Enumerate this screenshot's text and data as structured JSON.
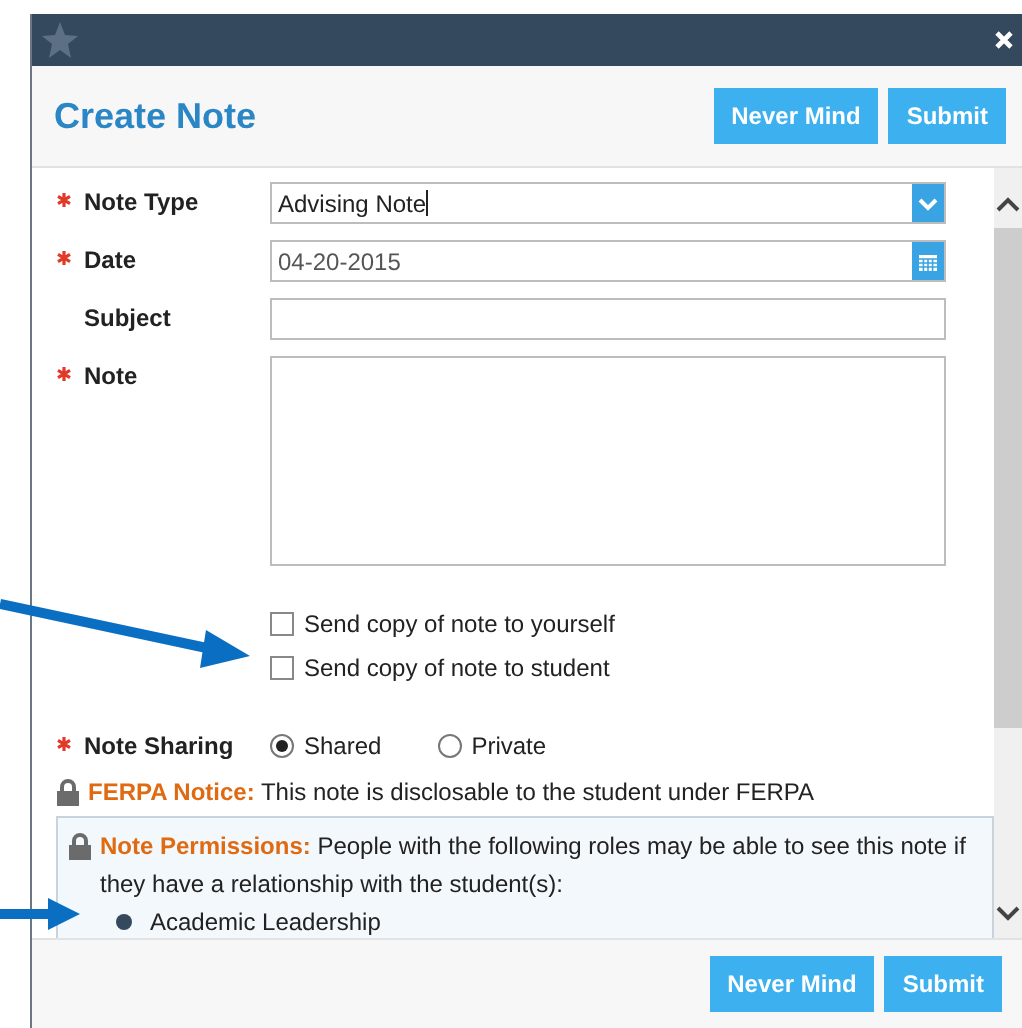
{
  "window": {
    "title": "Create Note"
  },
  "header_buttons": [
    "Never Mind",
    "Submit"
  ],
  "fields": [
    {
      "kind": "select",
      "label": "Note Type",
      "required": true,
      "value": "Advising Note"
    },
    {
      "kind": "date",
      "label": "Date",
      "required": true,
      "value": "04-20-2015"
    },
    {
      "kind": "text",
      "label": "Subject",
      "required": false
    },
    {
      "kind": "textarea",
      "label": "Note",
      "required": true
    }
  ],
  "checkboxes": [
    {
      "label": "Send copy of note to yourself",
      "checked": false
    },
    {
      "label": "Send copy of note to student",
      "checked": false
    }
  ],
  "sharing": {
    "label": "Note Sharing",
    "required": true,
    "options": [
      {
        "label": "Shared",
        "selected": true
      },
      {
        "label": "Private",
        "selected": false
      }
    ]
  },
  "ferpa": "**FERPA Notice:** This note is disclosable to the student under FERPA",
  "permissions": {
    "text": "**Note Permissions:** People with the following roles may be able to see this note if they have a relationship with the student(s):",
    "roles": [
      "Academic Leadership"
    ]
  },
  "footer_buttons": [
    "Never Mind",
    "Submit"
  ]
}
